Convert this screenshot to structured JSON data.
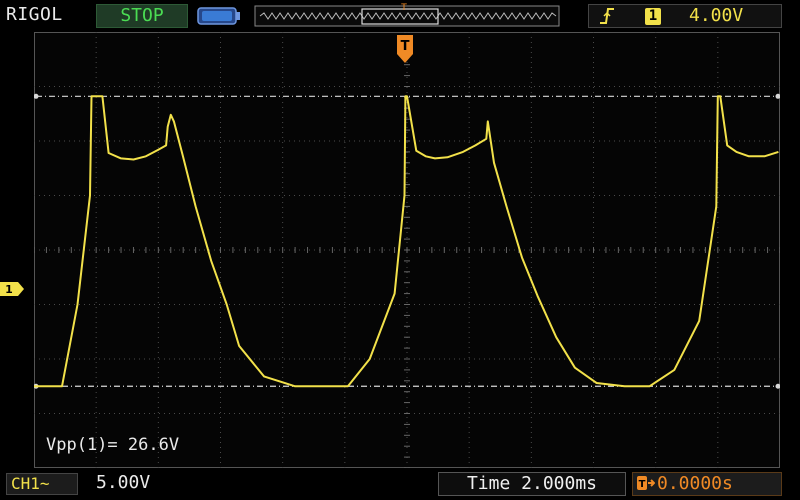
{
  "header": {
    "brand": "RIGOL",
    "run_state": "STOP",
    "trigger_source": "1",
    "trigger_level": "4.00V"
  },
  "icons": {
    "battery": "battery-icon",
    "memory": "memory-depth-icon",
    "trigger_edge": "rising-edge-icon",
    "channel_marker": "channel-1-ground-marker",
    "trigger_marker": "trigger-position-marker"
  },
  "colors": {
    "trace": "#f2e14a",
    "run_state": "#4bdc53",
    "trigger_offset": "#f08a25",
    "battery": "#3a7bd5"
  },
  "measurement": {
    "vpp": "Vpp(1)= 26.6V"
  },
  "footer": {
    "channel_label": "CH1",
    "coupling_symbol": "~",
    "volts_per_div": "5.00V",
    "time_base": "Time 2.000ms",
    "trigger_offset": "0.0000s"
  },
  "markers": {
    "channel_number": "1",
    "trigger_letter": "T"
  },
  "chart_data": {
    "type": "line",
    "xlabel": "",
    "ylabel": "",
    "x_unit": "ms",
    "y_unit": "V",
    "xlim": [
      -12,
      12
    ],
    "ylim": [
      -20,
      20
    ],
    "grid": true,
    "reference_levels": [
      -12.5,
      14.1
    ],
    "series": [
      {
        "x": [
          -12,
          -11.1,
          -10.6,
          -10.2,
          -10.15,
          -9.8,
          -9.6,
          -9.2,
          -8.8,
          -8.4,
          -8.0,
          -7.75,
          -7.7,
          -7.6,
          -7.5,
          -7.2,
          -6.8,
          -6.3,
          -5.8,
          -5.4,
          -4.6,
          -3.6,
          -2.6,
          -1.9,
          -1.2,
          -0.4,
          -0.08,
          -0.05,
          0,
          0.3,
          0.6,
          0.9,
          1.3,
          1.8,
          2.2,
          2.55,
          2.6,
          2.8,
          3.2,
          3.7,
          4.2,
          4.8,
          5.4,
          6.1,
          7.0,
          7.8,
          8.6,
          9.4,
          9.95,
          10.0,
          10.08,
          10.3,
          10.6,
          11.0,
          11.5,
          11.95
        ],
        "y": [
          -12.5,
          -12.5,
          -5,
          5,
          14.1,
          14.1,
          8.9,
          8.4,
          8.3,
          8.6,
          9.2,
          9.6,
          11.3,
          12.4,
          11.8,
          8.5,
          4.0,
          -1.0,
          -5.0,
          -8.8,
          -11.6,
          -12.5,
          -12.5,
          -12.5,
          -10.0,
          -4.0,
          5.0,
          14.1,
          14.1,
          9.1,
          8.6,
          8.4,
          8.5,
          9.0,
          9.6,
          10.2,
          11.8,
          8.0,
          4.0,
          -0.7,
          -4.2,
          -8.0,
          -10.8,
          -12.2,
          -12.5,
          -12.5,
          -11.0,
          -6.5,
          4.0,
          14.1,
          14.1,
          9.6,
          9.0,
          8.6,
          8.6,
          9.0
        ]
      }
    ]
  }
}
